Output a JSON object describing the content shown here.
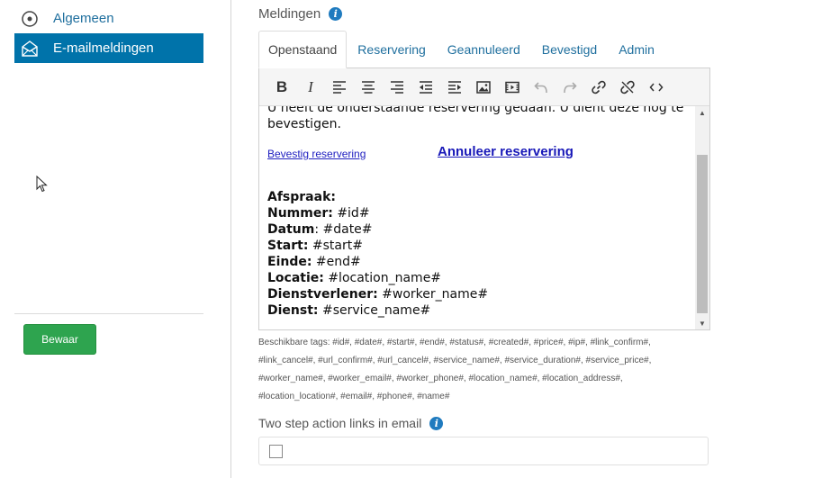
{
  "sidebar": {
    "items": [
      {
        "label": "Algemeen",
        "icon": "circle-dot-icon"
      },
      {
        "label": "E-mailmeldingen",
        "icon": "envelope-open-icon"
      }
    ],
    "save_label": "Bewaar"
  },
  "main": {
    "section_title": "Meldingen",
    "tabs": [
      {
        "label": "Openstaand"
      },
      {
        "label": "Reservering"
      },
      {
        "label": "Geannuleerd"
      },
      {
        "label": "Bevestigd"
      },
      {
        "label": "Admin"
      }
    ],
    "editor": {
      "intro": "U heeft de onderstaande reservering gedaan. U dient deze nog te bevestigen.",
      "confirm_link": "Bevestig reservering",
      "cancel_link": "Annuleer reservering",
      "appointment": [
        {
          "label": "Afspraak:",
          "value": ""
        },
        {
          "label": "Nummer:",
          "value": "#id#"
        },
        {
          "label": "Datum",
          "value": ": #date#"
        },
        {
          "label": "Start:",
          "value": "#start#"
        },
        {
          "label": "Einde:",
          "value": "#end#"
        },
        {
          "label": "Locatie:",
          "value": "#location_name#"
        },
        {
          "label": "Dienstverlener:",
          "value": "#worker_name#"
        },
        {
          "label": "Dienst:",
          "value": "#service_name#"
        }
      ]
    },
    "tags_text": "Beschikbare tags: #id#, #date#, #start#, #end#, #status#, #created#, #price#, #ip#, #link_confirm#, #link_cancel#, #url_confirm#, #url_cancel#, #service_name#, #service_duration#, #service_price#, #worker_name#, #worker_email#, #worker_phone#, #location_name#, #location_address#, #location_location#, #email#, #phone#, #name#",
    "two_step_label": "Two step action links in email"
  },
  "colors": {
    "accent": "#0073aa",
    "link": "#1f6f9e",
    "save": "#2ea44f",
    "info": "#1f7bbf"
  }
}
